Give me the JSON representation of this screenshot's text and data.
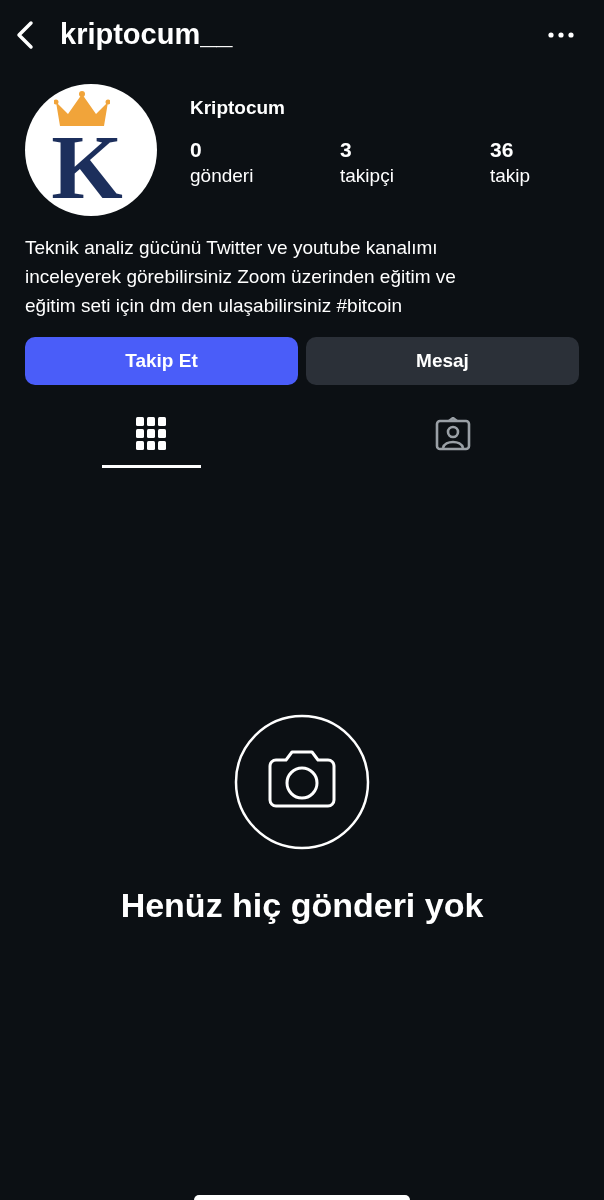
{
  "header": {
    "username": "kriptocum__"
  },
  "profile": {
    "avatar_letter": "K",
    "display_name": "Kriptocum",
    "stats": [
      {
        "value": "0",
        "label": "gönderi"
      },
      {
        "value": "3",
        "label": "takipçi"
      },
      {
        "value": "36",
        "label": "takip"
      }
    ],
    "bio": "Teknik analiz gücünü Twitter ve youtube kanalımı inceleyerek görebilirsiniz Zoom üzerinden eğitim ve eğitim seti için dm den ulaşabilirsiniz #bitcoin"
  },
  "buttons": [
    {
      "label": "Takip Et",
      "kind": "primary"
    },
    {
      "label": "Mesaj",
      "kind": "secondary"
    }
  ],
  "tabs": [
    {
      "kind": "grid",
      "selected": true
    },
    {
      "kind": "tagged",
      "selected": false
    }
  ],
  "empty_state": {
    "message": "Henüz hiç gönderi yok"
  }
}
